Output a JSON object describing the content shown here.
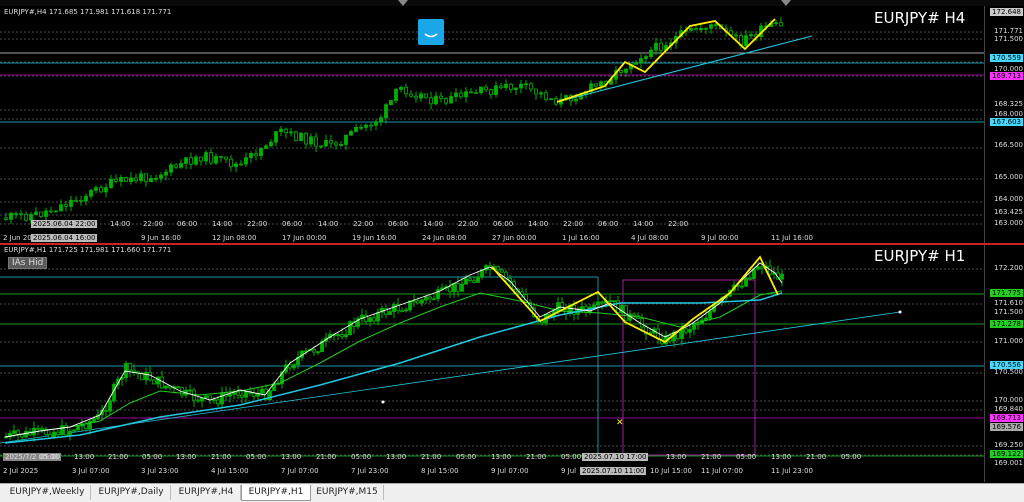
{
  "top_chart": {
    "info": "EURJPY#,H4  171.685 171.981 171.618 171.771",
    "title": "EURJPY# H4",
    "price_labels": {
      "p1": "172.648",
      "p2": "171.771",
      "p3": "171.500",
      "p4": "170.559",
      "p5": "170.000",
      "p6": "169.713",
      "p7": "168.325",
      "p8": "168.000",
      "p9": "167.603",
      "p10": "166.500",
      "p11": "165.000",
      "p12": "164.000",
      "p13": "163.425",
      "p14": "163.000"
    },
    "time_labels": {
      "t1": "2 Jun 20",
      "t2": "9 Jun 16:00",
      "t3": "12 Jun 08:00",
      "t4": "17 Jun 00:00",
      "t5": "19 Jun 16:00",
      "t6": "24 Jun 08:00",
      "t7": "27 Jun 00:00",
      "t8": "1 Jul 16:00",
      "t9": "4 Jul 08:00",
      "t10": "9 Jul 00:00",
      "t11": "11 Jul 16:00"
    },
    "hour_labels": {
      "h1": "14:00",
      "h2": "22:00",
      "h3": "06:00",
      "h4": "14:00",
      "h5": "22:00",
      "h6": "06:00",
      "h7": "14:00",
      "h8": "22:00",
      "h9": "06:00",
      "h10": "14:00",
      "h11": "22:00",
      "h12": "06:00",
      "h13": "14:00",
      "h14": "22:00",
      "h15": "06:00",
      "h16": "14:00",
      "h17": "22:00"
    },
    "date_box_1": "2025.06.04 22:00",
    "date_box_2": "2025.06.04 16:00"
  },
  "bottom_chart": {
    "info": "EURJPY#,H1  171.725 171.981 171.660 171.771",
    "title": "EURJPY# H1",
    "hide_button": "IAs Hid",
    "price_labels": {
      "p1": "172.200",
      "p2": "171.775",
      "p3": "171.610",
      "p4": "171.500",
      "p5": "171.278",
      "p6": "171.000",
      "p7": "170.556",
      "p8": "170.500",
      "p9": "170.000",
      "p10": "169.840",
      "p11": "169.713",
      "p12": "169.576",
      "p13": "169.250",
      "p14": "169.122",
      "p15": "169.001"
    },
    "time_labels": {
      "t1": "2 Jul 2025",
      "t2": "3 Jul 07:00",
      "t3": "3 Jul 23:00",
      "t4": "4 Jul 15:00",
      "t5": "7 Jul 07:00",
      "t6": "7 Jul 23:00",
      "t7": "8 Jul 15:00",
      "t8": "9 Jul 07:00",
      "t9": "9 Jul",
      "t10": "10 Jul 15:00",
      "t11": "11 Jul 07:00",
      "t12": "11 Jul 23:00"
    },
    "hour_labels": {
      "h1": "05:00",
      "h2": "13:00",
      "h3": "21:00",
      "h4": "05:00",
      "h5": "13:00",
      "h6": "21:00",
      "h7": "05:00",
      "h8": "13:00",
      "h9": "21:00",
      "h10": "05:00",
      "h11": "13:00",
      "h12": "21:00",
      "h13": "05:00",
      "h14": "13:00",
      "h15": "21:00",
      "h16": "05:00",
      "h17": "13:00",
      "h18": "21:00",
      "h19": "05:00",
      "h20": "13:00",
      "h21": "21:00",
      "h22": "05:00"
    },
    "date_box_left": "2025/7/2 05:00",
    "date_box_1": "2025.07.10 17:00",
    "date_box_2": "2025.07.10 11:00"
  },
  "tabs": {
    "t1": "EURJPY#,Weekly",
    "t2": "EURJPY#,Daily",
    "t3": "EURJPY#,H4",
    "t4": "EURJPY#,H1",
    "t5": "EURJPY#,M15"
  },
  "colors": {
    "bull": "#00b000",
    "bear": "#00b000",
    "ma_white": "#ffffff",
    "ma_green": "#22cc22",
    "ma_cyan": "#22c8e0",
    "zigzag": "#ffee00",
    "magenta": "#c000c0",
    "separator": "#cc2222"
  }
}
